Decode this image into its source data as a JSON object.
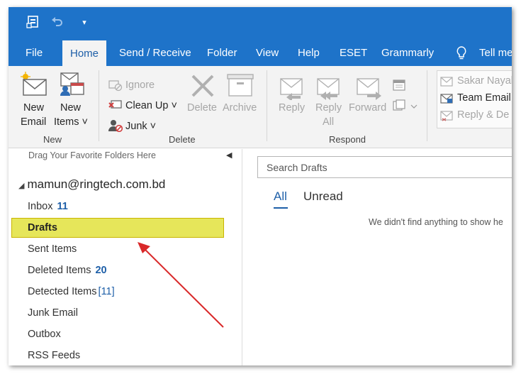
{
  "colors": {
    "accent": "#1e73c9",
    "highlight": "#e6e65a",
    "arrow": "#d9292a"
  },
  "tabs": [
    {
      "label": "File"
    },
    {
      "label": "Home"
    },
    {
      "label": "Send / Receive"
    },
    {
      "label": "Folder"
    },
    {
      "label": "View"
    },
    {
      "label": "Help"
    },
    {
      "label": "ESET"
    },
    {
      "label": "Grammarly"
    },
    {
      "label": "Tell me"
    }
  ],
  "ribbon": {
    "new_email": [
      "New",
      "Email"
    ],
    "new_items": [
      "New",
      "Items ˅"
    ],
    "new_group": "New",
    "ignore": "Ignore",
    "clean_up": "Clean Up ˅",
    "junk": "Junk ˅",
    "delete": "Delete",
    "archive": "Archive",
    "delete_group": "Delete",
    "reply": "Reply",
    "reply_all": [
      "Reply",
      "All"
    ],
    "forward": "Forward",
    "respond_group": "Respond",
    "quick_steps": [
      "Sakar Nayal",
      "Team Email",
      "Reply & De"
    ]
  },
  "folder_pane": {
    "drag_hint": "Drag Your Favorite Folders Here",
    "account": "mamun@ringtech.com.bd",
    "folders": [
      {
        "name": "Inbox",
        "count": "11"
      },
      {
        "name": "Drafts",
        "count": ""
      },
      {
        "name": "Sent Items",
        "count": ""
      },
      {
        "name": "Deleted Items",
        "count": "20"
      },
      {
        "name": "Detected Items",
        "count": "[11]"
      },
      {
        "name": "Junk Email",
        "count": ""
      },
      {
        "name": "Outbox",
        "count": ""
      },
      {
        "name": "RSS Feeds",
        "count": ""
      }
    ]
  },
  "message_list": {
    "search_placeholder": "Search Drafts",
    "filter_all": "All",
    "filter_unread": "Unread",
    "empty_text": "We didn't find anything to show he"
  }
}
